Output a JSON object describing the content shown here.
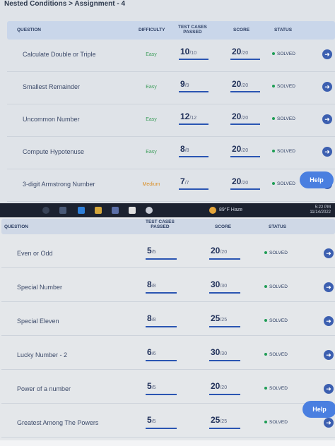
{
  "breadcrumb": "Nested Conditions > Assignment - 4",
  "columns": {
    "question": "QUESTION",
    "difficulty": "DIFFICULTY",
    "tests_l1": "TEST CASES",
    "tests_l2": "PASSED",
    "score": "SCORE",
    "status": "STATUS"
  },
  "help_label": "Help",
  "rows1": [
    {
      "name": "Calculate Double or Triple",
      "difficulty": "Easy",
      "tests": "10",
      "tests_total": "/10",
      "score": "20",
      "score_total": "/20",
      "status": "SOLVED",
      "tests_frac": 1.0
    },
    {
      "name": "Smallest Remainder",
      "difficulty": "Easy",
      "tests": "9",
      "tests_total": "/9",
      "score": "20",
      "score_total": "/20",
      "status": "SOLVED",
      "tests_frac": 1.0
    },
    {
      "name": "Uncommon Number",
      "difficulty": "Easy",
      "tests": "12",
      "tests_total": "/12",
      "score": "20",
      "score_total": "/20",
      "status": "SOLVED",
      "tests_frac": 1.0
    },
    {
      "name": "Compute Hypotenuse",
      "difficulty": "Easy",
      "tests": "8",
      "tests_total": "/8",
      "score": "20",
      "score_total": "/20",
      "status": "SOLVED",
      "tests_frac": 1.0
    },
    {
      "name": "3-digit Armstrong Number",
      "difficulty": "Medium",
      "tests": "7",
      "tests_total": "/7",
      "score": "20",
      "score_total": "/20",
      "status": "SOLVED",
      "tests_frac": 1.0
    }
  ],
  "rows2": [
    {
      "name": "Even or Odd",
      "tests": "5",
      "tests_total": "/5",
      "score": "20",
      "score_total": "/20",
      "status": "SOLVED"
    },
    {
      "name": "Special Number",
      "tests": "8",
      "tests_total": "/8",
      "score": "30",
      "score_total": "/30",
      "status": "SOLVED"
    },
    {
      "name": "Special Eleven",
      "tests": "8",
      "tests_total": "/8",
      "score": "25",
      "score_total": "/25",
      "status": "SOLVED"
    },
    {
      "name": "Lucky Number - 2",
      "tests": "6",
      "tests_total": "/6",
      "score": "30",
      "score_total": "/30",
      "status": "SOLVED"
    },
    {
      "name": "Power of a number",
      "tests": "5",
      "tests_total": "/5",
      "score": "20",
      "score_total": "/20",
      "status": "SOLVED"
    },
    {
      "name": "Greatest Among The Powers",
      "tests": "5",
      "tests_total": "/5",
      "score": "25",
      "score_total": "/25",
      "status": "SOLVED"
    }
  ],
  "taskbar": {
    "weather": "89°F Haze",
    "time": "5:22 PM",
    "date": "11/14/2022"
  },
  "colors": {
    "easy": "#3e9d5c",
    "medium": "#d9902b",
    "accent": "#2a55b2",
    "solved_dot": "#1f9d55"
  }
}
